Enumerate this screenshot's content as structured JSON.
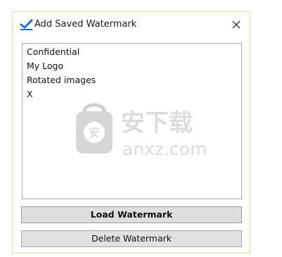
{
  "window": {
    "title": "Add Saved Watermark",
    "accent": "#1f6fd1"
  },
  "list": {
    "items": [
      "Confidential",
      "My Logo",
      "Rotated images",
      "X"
    ]
  },
  "buttons": {
    "load": "Load Watermark",
    "delete": "Delete Watermark"
  },
  "watermark": {
    "main": "安下载",
    "sub": "anxz.com",
    "badge": "安"
  }
}
